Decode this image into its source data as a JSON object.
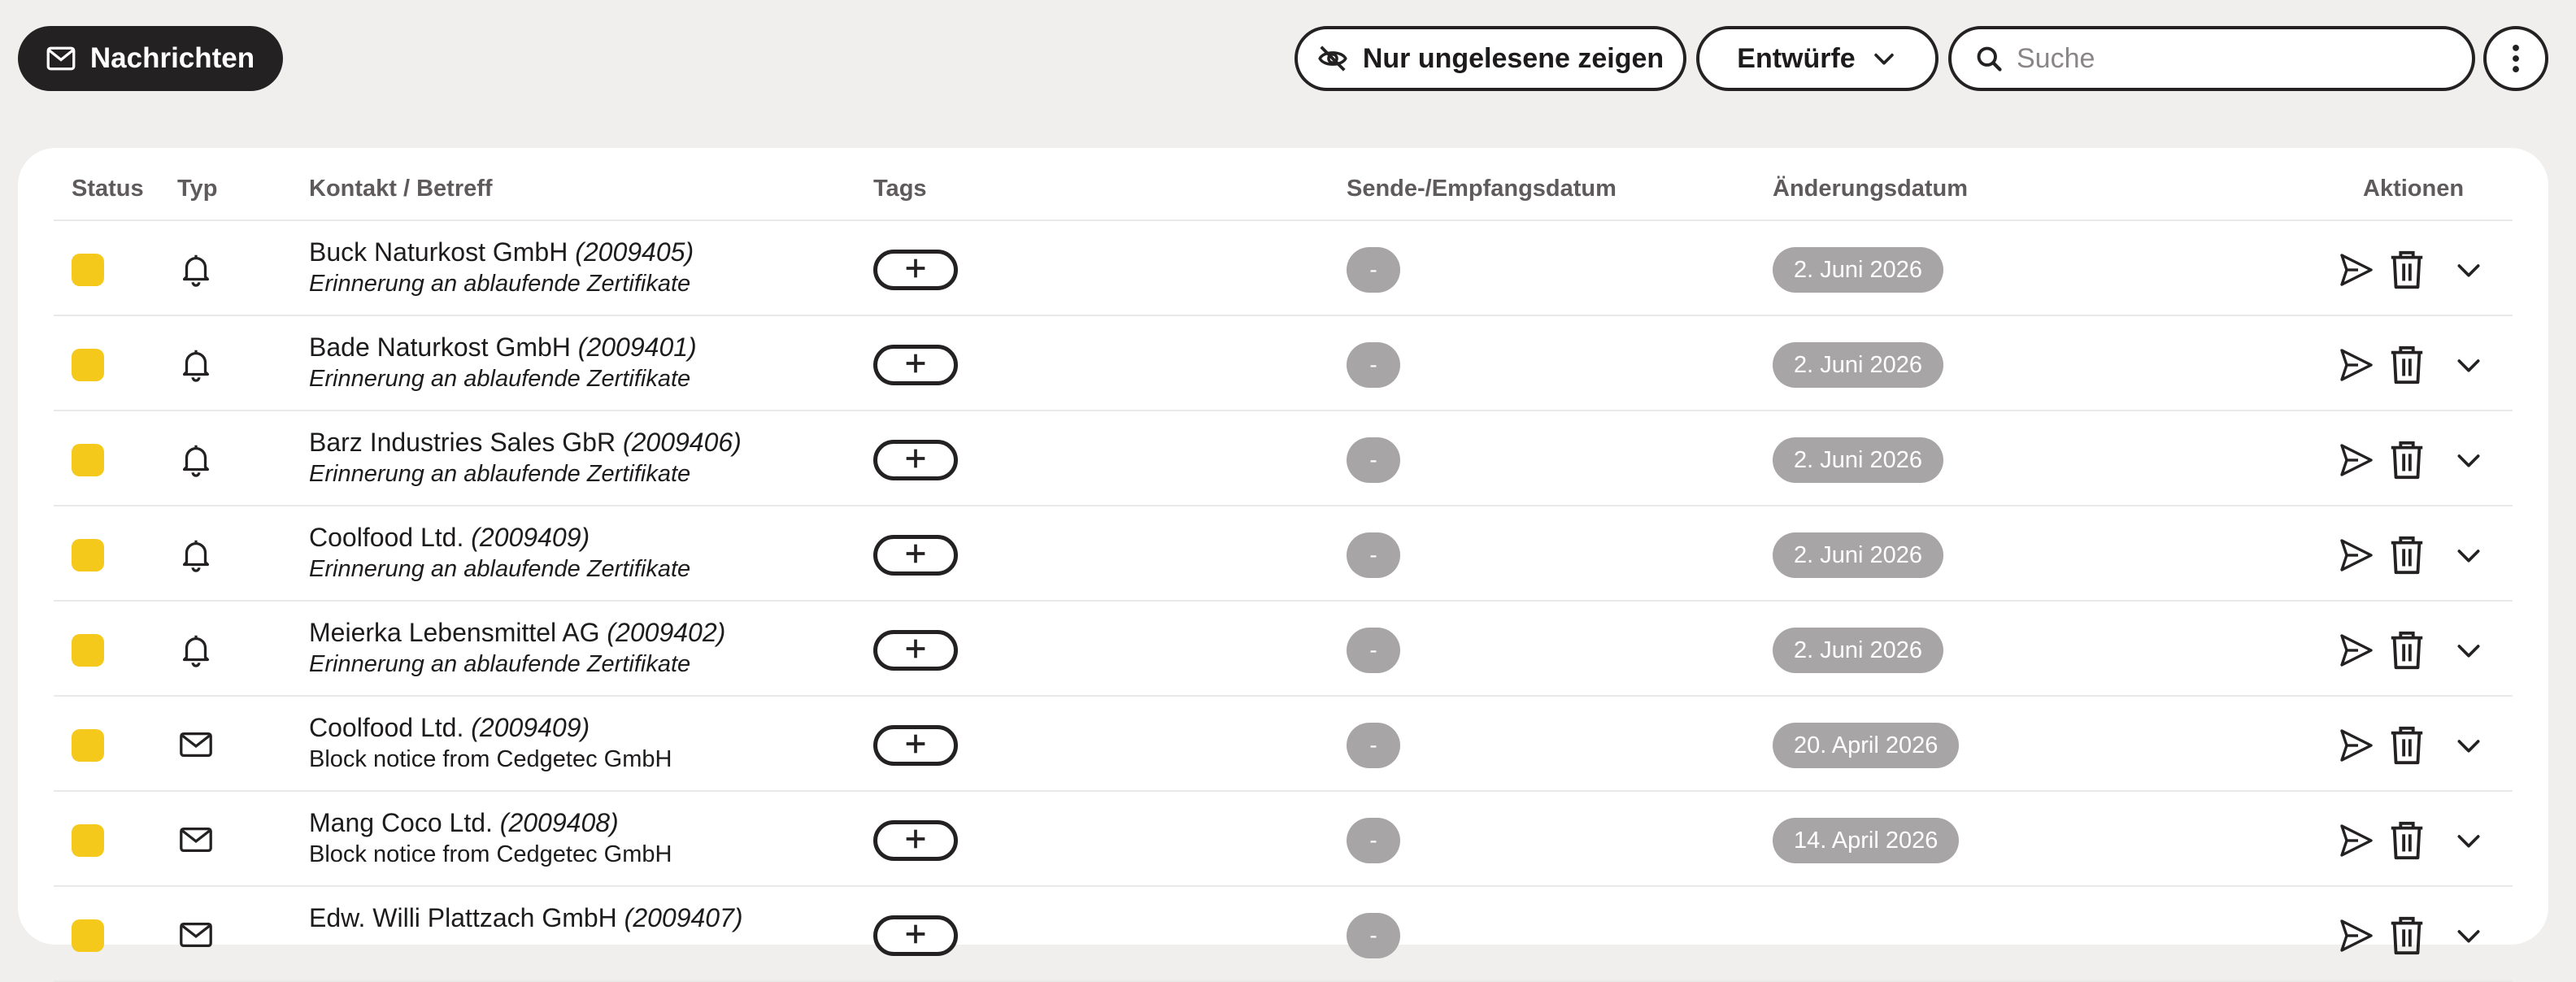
{
  "toolbar": {
    "messages_button": "Nachrichten",
    "unread_button": "Nur ungelesene zeigen",
    "drafts_select": "Entwürfe",
    "search_placeholder": "Suche",
    "icons": {
      "messages": "envelope-icon",
      "unread": "eye-off-icon",
      "drafts": "chevron-down-icon",
      "search": "search-icon",
      "more": "more-vertical-icon"
    }
  },
  "table": {
    "headers": {
      "status": "Status",
      "type": "Typ",
      "contact": "Kontakt / Betreff",
      "tags": "Tags",
      "send_date": "Sende-/Empfangsdatum",
      "mod_date": "Änderungsdatum",
      "actions": "Aktionen"
    },
    "rows": [
      {
        "type": "bell",
        "name": "Buck Naturkost GmbH",
        "id": "(2009405)",
        "subject": "Erinnerung an ablaufende Zertifikate",
        "send_date": "-",
        "mod_date": "2. Juni 2026"
      },
      {
        "type": "bell",
        "name": "Bade Naturkost GmbH",
        "id": "(2009401)",
        "subject": "Erinnerung an ablaufende Zertifikate",
        "send_date": "-",
        "mod_date": "2. Juni 2026"
      },
      {
        "type": "bell",
        "name": "Barz Industries Sales GbR",
        "id": "(2009406)",
        "subject": "Erinnerung an ablaufende Zertifikate",
        "send_date": "-",
        "mod_date": "2. Juni 2026"
      },
      {
        "type": "bell",
        "name": "Coolfood Ltd.",
        "id": "(2009409)",
        "subject": "Erinnerung an ablaufende Zertifikate",
        "send_date": "-",
        "mod_date": "2. Juni 2026"
      },
      {
        "type": "bell",
        "name": "Meierka Lebensmittel AG",
        "id": "(2009402)",
        "subject": "Erinnerung an ablaufende Zertifikate",
        "send_date": "-",
        "mod_date": "2. Juni 2026"
      },
      {
        "type": "mail",
        "name": "Coolfood Ltd.",
        "id": "(2009409)",
        "subject": "Block notice from Cedgetec GmbH",
        "send_date": "-",
        "mod_date": "20. April 2026"
      },
      {
        "type": "mail",
        "name": "Mang Coco Ltd.",
        "id": "(2009408)",
        "subject": "Block notice from Cedgetec GmbH",
        "send_date": "-",
        "mod_date": "14. April 2026"
      },
      {
        "type": "mail",
        "name": "Edw. Willi Plattzach GmbH",
        "id": "(2009407)",
        "subject": "",
        "send_date": "-",
        "mod_date": ""
      }
    ]
  },
  "colors": {
    "status_unread": "#f5c91c",
    "date_badge": "#a8a5a6",
    "primary_dark": "#242122",
    "page_bg": "#f1eeee"
  }
}
